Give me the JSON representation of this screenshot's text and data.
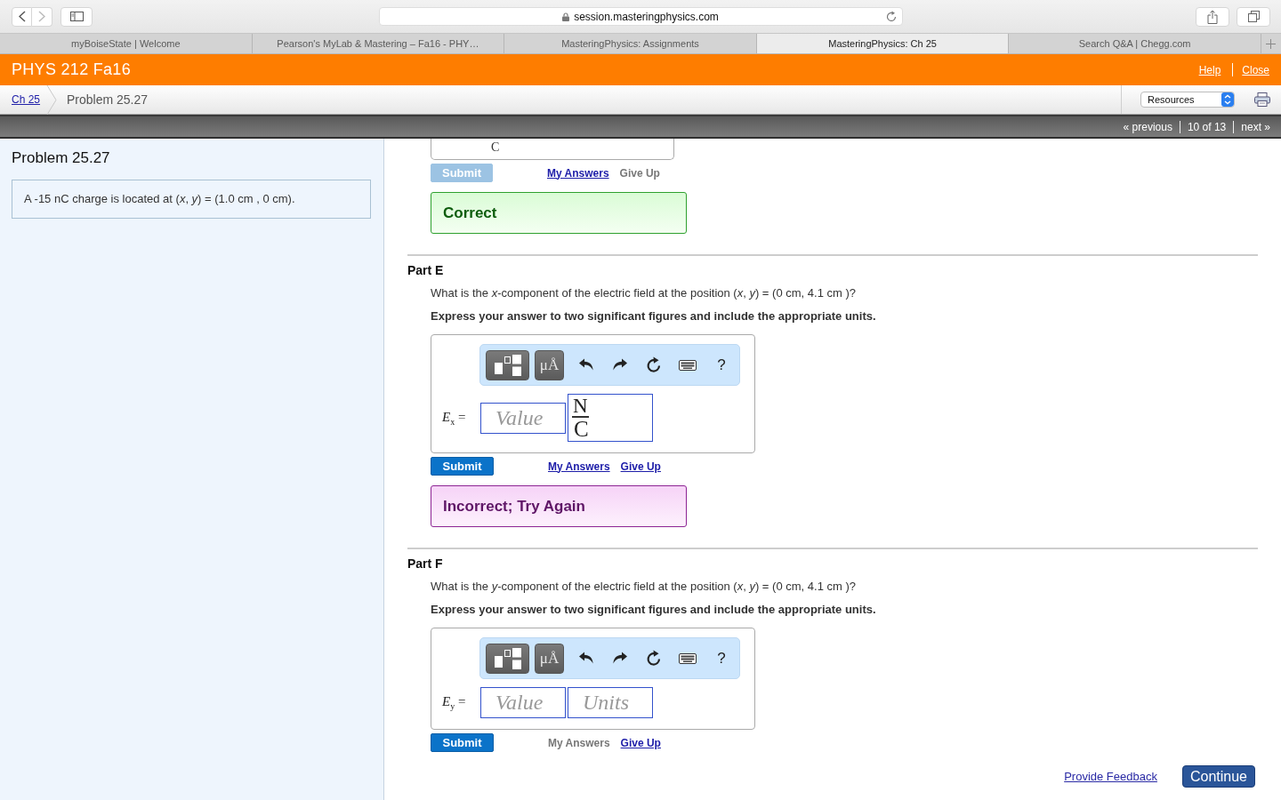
{
  "browser": {
    "address": "session.masteringphysics.com",
    "tabs": [
      {
        "label": "myBoiseState | Welcome",
        "selected": false
      },
      {
        "label": "Pearson's MyLab & Mastering – Fa16 - PHY…",
        "selected": false
      },
      {
        "label": "MasteringPhysics: Assignments",
        "selected": false
      },
      {
        "label": "MasteringPhysics: Ch 25",
        "selected": true
      },
      {
        "label": "Search Q&A | Chegg.com",
        "selected": false
      }
    ]
  },
  "header": {
    "course": "PHYS 212 Fa16",
    "links": [
      "Help",
      "Close"
    ]
  },
  "breadcrumb": {
    "items": [
      {
        "label": "Ch 25",
        "kind": "link"
      },
      {
        "label": "Problem 25.27",
        "kind": "current"
      }
    ],
    "resources": "Resources"
  },
  "pager": {
    "previous": "« previous",
    "position": "10 of 13",
    "next": "next »"
  },
  "problem": {
    "title": "Problem 25.27",
    "statement": "A -15 nC charge is located at (*x*, *y*) = (1.0 cm , 0 cm)."
  },
  "previous_part": {
    "unit": "C",
    "actions": {
      "submit": {
        "label": "Submit",
        "disabled": true
      },
      "my_answers": {
        "label": "My Answers",
        "disabled": false
      },
      "give_up": {
        "label": "Give Up",
        "disabled": true
      }
    },
    "feedback": {
      "kind": "correct",
      "text": "Correct"
    }
  },
  "parts": [
    {
      "title": "Part E",
      "question": "What is the *x*-component of the electric field at the position (*x*, *y*) = (0 cm, 4.1 cm )?",
      "instruction": "Express your answer to two significant figures and include the appropriate units.",
      "toolbar": {
        "symbols": "μÅ",
        "help": "?"
      },
      "label": "*E*$_{x}$ =",
      "value": {
        "placeholder": "Value"
      },
      "units": {
        "kind": "fraction",
        "numerator": "N",
        "denominator": "C"
      },
      "actions": {
        "submit": {
          "label": "Submit",
          "disabled": false
        },
        "my_answers": {
          "label": "My Answers",
          "disabled": false
        },
        "give_up": {
          "label": "Give Up",
          "disabled": false
        }
      },
      "feedback": {
        "kind": "incorrect",
        "text": "Incorrect; Try Again"
      }
    },
    {
      "title": "Part F",
      "question": "What is the *y*-component of the electric field at the position (*x*, *y*) = (0 cm, 4.1 cm )?",
      "instruction": "Express your answer to two significant figures and include the appropriate units.",
      "toolbar": {
        "symbols": "μÅ",
        "help": "?"
      },
      "label": "*E*$_{y}$ =",
      "value": {
        "placeholder": "Value"
      },
      "units": {
        "kind": "input",
        "placeholder": "Units"
      },
      "actions": {
        "submit": {
          "label": "Submit",
          "disabled": false
        },
        "my_answers": {
          "label": "My Answers",
          "disabled": true
        },
        "give_up": {
          "label": "Give Up",
          "disabled": false
        }
      }
    }
  ],
  "footer": {
    "feedback_link": "Provide Feedback",
    "continue": "Continue"
  }
}
